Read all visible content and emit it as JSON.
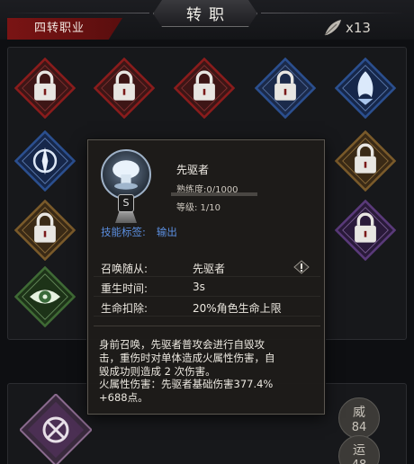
{
  "header": {
    "title": "转职",
    "section_tab": "四转职业",
    "currency_value": "x13",
    "currency_icon": "feather-icon"
  },
  "grid": {
    "nodes": [
      {
        "icon": "lock-icon",
        "locked": true
      },
      {
        "icon": "lock-icon",
        "locked": true
      },
      {
        "icon": "lock-icon",
        "locked": true
      },
      {
        "icon": "lock-icon",
        "locked": true
      },
      {
        "icon": "spirit-icon",
        "locked": false
      },
      {
        "icon": "compass-icon",
        "locked": false
      },
      {
        "icon": "lock-icon",
        "locked": true
      },
      {
        "icon": "lock-icon",
        "locked": true
      },
      {
        "icon": "lock-icon",
        "locked": true
      },
      {
        "icon": "eye-icon",
        "locked": false
      }
    ]
  },
  "bottom": {
    "stats": [
      {
        "key": "威",
        "value": "84"
      },
      {
        "key": "运",
        "value": "48"
      }
    ]
  },
  "tooltip": {
    "skill_name": "先驱者",
    "proficiency": "熟练度:0/1000",
    "proficiency_fraction": 0,
    "level": "等级: 1/10",
    "grade": "S",
    "tag_label": "技能标签:",
    "tag_value": "输出",
    "attributes": [
      {
        "key": "召唤随从:",
        "value": "先驱者"
      },
      {
        "key": "重生时间:",
        "value": "3s"
      },
      {
        "key": "生命扣除:",
        "value": "20%角色生命上限"
      }
    ],
    "description": "身前召唤，先驱者普攻会进行自毁攻\n击，重伤时对单体造成火属性伤害，自\n毁成功则造成 2 次伤害。",
    "damage": "火属性伤害：先驱者基础伤害377.4%\n+688点。"
  },
  "colors": {
    "accent_red": "#7a1414",
    "locked_frame": "#8a1c1c",
    "tag_blue": "#5c8fe0"
  }
}
